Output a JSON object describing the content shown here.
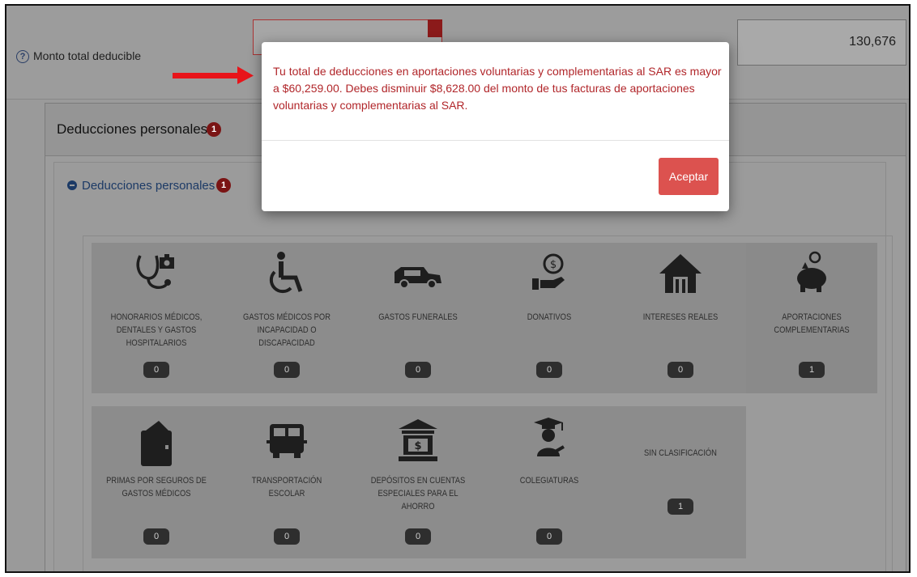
{
  "header": {
    "monto_label": "Monto total deducible",
    "total_value": "130,676"
  },
  "panel": {
    "title": "Deducciones personales",
    "badge": "1",
    "section_title": "Deducciones personales",
    "section_badge": "1"
  },
  "categories_row1": [
    {
      "label": "HONORARIOS MÉDICOS, DENTALES Y GASTOS HOSPITALARIOS",
      "count": "0",
      "icon": "stethoscope-icon"
    },
    {
      "label": "GASTOS MÉDICOS POR INCAPACIDAD O DISCAPACIDAD",
      "count": "0",
      "icon": "wheelchair-icon"
    },
    {
      "label": "GASTOS FUNERALES",
      "count": "0",
      "icon": "hearse-icon"
    },
    {
      "label": "DONATIVOS",
      "count": "0",
      "icon": "donation-icon"
    },
    {
      "label": "INTERESES REALES",
      "count": "0",
      "icon": "house-icon"
    },
    {
      "label": "APORTACIONES COMPLEMENTARIAS",
      "count": "1",
      "icon": "piggy-bank-icon"
    }
  ],
  "categories_row2": [
    {
      "label": "PRIMAS POR SEGUROS DE GASTOS MÉDICOS",
      "count": "0",
      "icon": "wallet-icon"
    },
    {
      "label": "TRANSPORTACIÓN ESCOLAR",
      "count": "0",
      "icon": "school-bus-icon"
    },
    {
      "label": "DEPÓSITOS EN CUENTAS ESPECIALES PARA EL AHORRO",
      "count": "0",
      "icon": "bank-icon"
    },
    {
      "label": "COLEGIATURAS",
      "count": "0",
      "icon": "graduate-icon"
    },
    {
      "label": "SIN CLASIFICACIÓN",
      "count": "1",
      "icon": ""
    }
  ],
  "modal": {
    "message": "Tu total de deducciones en aportaciones voluntarias y complementarias al SAR es mayor a $60,259.00. Debes disminuir $8,628.00 del monto de tus facturas de aportaciones voluntarias y complementarias al SAR.",
    "button_label": "Aceptar"
  },
  "colors": {
    "overlay": "#9a9a9a",
    "modal_text": "#b1262a",
    "button_bg": "#dc524f",
    "badge_bg": "#7a1414",
    "arrow": "#e8141a"
  }
}
